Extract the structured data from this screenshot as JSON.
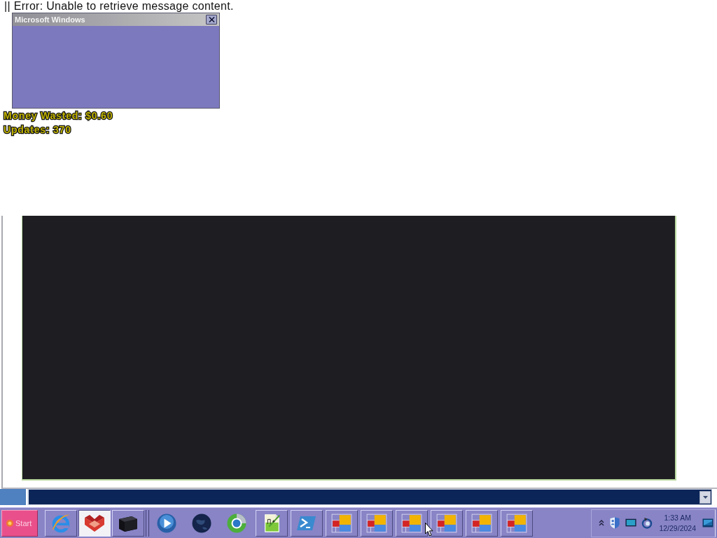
{
  "message": {
    "text": "|| Error: Unable to retrieve message content."
  },
  "dialog": {
    "title": "Microsoft Windows"
  },
  "stats": [
    "Money Wasted: $0.60",
    "Updates: 370"
  ],
  "taskbar": {
    "start": {
      "label": "Start"
    },
    "quick_launch": [
      {
        "selected": false
      },
      {
        "selected": true
      },
      {
        "selected": false
      }
    ],
    "apps": [
      {
        "selected": false
      },
      {
        "selected": false
      }
    ],
    "windows": [
      {
        "selected": false
      },
      {
        "selected": false
      },
      {
        "selected": false
      },
      {
        "selected": false
      },
      {
        "selected": false
      },
      {
        "selected": false
      }
    ],
    "clock": {
      "time": "1:33 AM",
      "date": "12/29/2024"
    }
  }
}
